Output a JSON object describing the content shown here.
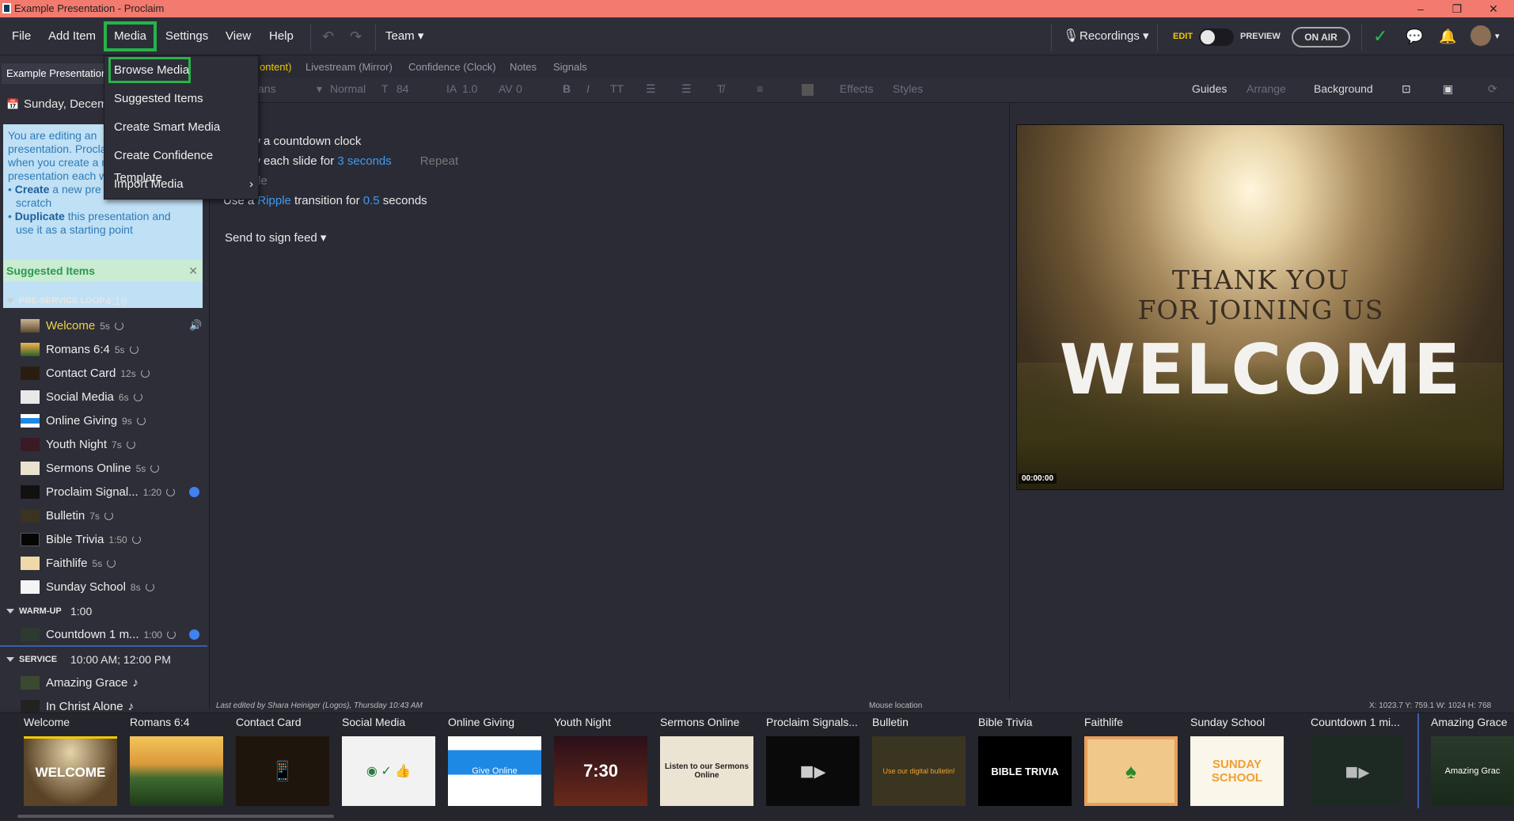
{
  "window": {
    "title": "Example Presentation - Proclaim"
  },
  "menu": [
    "File",
    "Add Item",
    "Media",
    "Settings",
    "View",
    "Help"
  ],
  "toolbar": {
    "team": "Team",
    "recordings": "Recordings",
    "edit": "EDIT",
    "preview": "PREVIEW",
    "on_air": "ON AIR"
  },
  "dropdown": {
    "items": [
      "Browse Media",
      "Suggested Items",
      "Create Smart Media",
      "Create Confidence Template",
      "Import Media"
    ]
  },
  "left": {
    "pres_tab": "Example Presentation",
    "date": "Sunday, Decemb",
    "info": {
      "line1": "You are editing an",
      "line2": "presentation. Procla",
      "line3": "when you create a n",
      "line4": "presentation each w",
      "create_bold": "Create",
      "create_rest": " a new pre",
      "create_rest2": "scratch",
      "dup_bold": "Duplicate",
      "dup_rest": " this presentation and",
      "dup_rest2": "use it as a starting point"
    },
    "suggested": "Suggested Items",
    "sections": [
      {
        "title": "PRE-SERVICE LOOP",
        "duration": "4:19"
      },
      {
        "title": "WARM-UP",
        "duration": "1:00"
      },
      {
        "title": "SERVICE",
        "duration": "10:00 AM; 12:00 PM"
      }
    ],
    "items": [
      {
        "name": "Welcome",
        "dur": "5s"
      },
      {
        "name": "Romans 6:4",
        "dur": "5s"
      },
      {
        "name": "Contact Card",
        "dur": "12s"
      },
      {
        "name": "Social Media",
        "dur": "6s"
      },
      {
        "name": "Online Giving",
        "dur": "9s"
      },
      {
        "name": "Youth Night",
        "dur": "7s"
      },
      {
        "name": "Sermons Online",
        "dur": "5s"
      },
      {
        "name": "Proclaim Signal...",
        "dur": "1:20"
      },
      {
        "name": "Bulletin",
        "dur": "7s"
      },
      {
        "name": "Bible Trivia",
        "dur": "1:50"
      },
      {
        "name": "Faithlife",
        "dur": "5s"
      },
      {
        "name": "Sunday School",
        "dur": "8s"
      },
      {
        "name": "Countdown 1 m...",
        "dur": "1:00"
      },
      {
        "name": "Amazing Grace",
        "dur": ""
      },
      {
        "name": "In Christ Alone",
        "dur": ""
      }
    ]
  },
  "tabs": [
    "ontent)",
    "Livestream (Mirror)",
    "Confidence (Clock)",
    "Notes",
    "Signals"
  ],
  "format": {
    "font": "ans",
    "weight": "Normal",
    "size": "84",
    "line": "1.0",
    "spacing": "0",
    "effects": "Effects",
    "styles": "Styles",
    "guides": "Guides",
    "arrange": "Arrange",
    "background": "Background"
  },
  "content": {
    "l1": "w a countdown clock",
    "l2a": "w each slide for ",
    "l2b": "3 seconds",
    "l2c": "Repeat",
    "l3": "ffle",
    "l4a": "Use a ",
    "l4b": "Ripple",
    "l4c": " transition for ",
    "l4d": "0.5",
    "l4e": " seconds",
    "send": "Send to sign feed"
  },
  "preview": {
    "line1": "THANK YOU",
    "line2": "FOR JOINING US",
    "big": "WELCOME",
    "timecode": "00:00:00"
  },
  "status": {
    "edited": "Last edited by Shara Heiniger (Logos), Thursday 10:43 AM",
    "mouse": "Mouse location",
    "coords": "X: 1023.7  Y: 759.1    W: 1024  H: 768"
  },
  "strip": [
    {
      "name": "Welcome",
      "thumb": "WELCOME"
    },
    {
      "name": "Romans 6:4",
      "thumb": ""
    },
    {
      "name": "Contact Card",
      "thumb": ""
    },
    {
      "name": "Social Media",
      "thumb": ""
    },
    {
      "name": "Online Giving",
      "thumb": "Give Online"
    },
    {
      "name": "Youth Night",
      "thumb": "7:30"
    },
    {
      "name": "Sermons Online",
      "thumb": "Listen to our Sermons Online"
    },
    {
      "name": "Proclaim Signals...",
      "thumb": ""
    },
    {
      "name": "Bulletin",
      "thumb": "Use our digital bulletin!"
    },
    {
      "name": "Bible Trivia",
      "thumb": "BIBLE TRIVIA"
    },
    {
      "name": "Faithlife",
      "thumb": ""
    },
    {
      "name": "Sunday School",
      "thumb": "SUNDAY SCHOOL"
    },
    {
      "name": "Countdown 1 mi...",
      "thumb": ""
    },
    {
      "name": "Amazing Grace",
      "thumb": "Amazing Grac"
    }
  ]
}
